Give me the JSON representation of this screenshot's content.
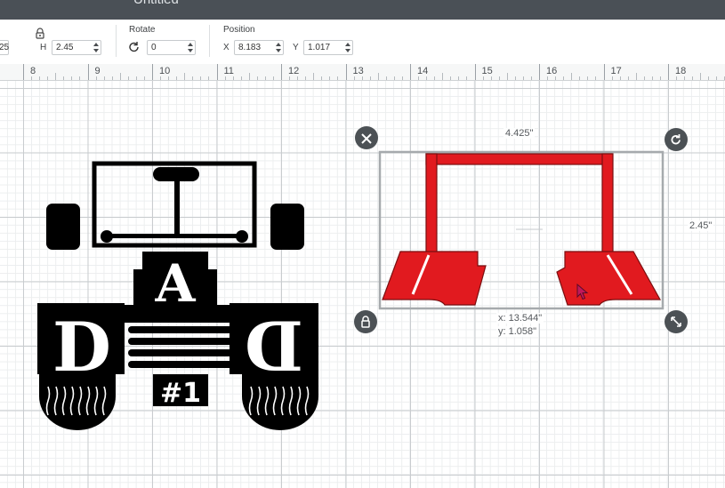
{
  "window": {
    "title": "Untitled"
  },
  "toolbar": {
    "size": {
      "w_partial": "25",
      "h_label": "H",
      "h_value": "2.45"
    },
    "rotate": {
      "label": "Rotate",
      "value": "0"
    },
    "position": {
      "label": "Position",
      "x_label": "X",
      "x_value": "8.183",
      "y_label": "Y",
      "y_value": "1.017"
    }
  },
  "ruler": {
    "labels": [
      "8",
      "9",
      "10",
      "11",
      "12",
      "13",
      "14",
      "15",
      "16",
      "17",
      "18"
    ]
  },
  "canvas": {
    "left_design": {
      "letters": [
        "D",
        "A",
        "D"
      ],
      "badge": "#1"
    },
    "selection": {
      "width_label": "4.425\"",
      "height_label": "2.45\"",
      "coord_x": "x: 13.544\"",
      "coord_y": "y: 1.058\""
    }
  },
  "colors": {
    "accent_red": "#e11a1f",
    "handle": "#4c5155",
    "titlebar": "#4a5056"
  },
  "icons": [
    "lock-icon",
    "rotate-icon",
    "close-icon",
    "rotate-handle-icon",
    "lock-handle-icon",
    "resize-icon",
    "cursor-icon"
  ]
}
